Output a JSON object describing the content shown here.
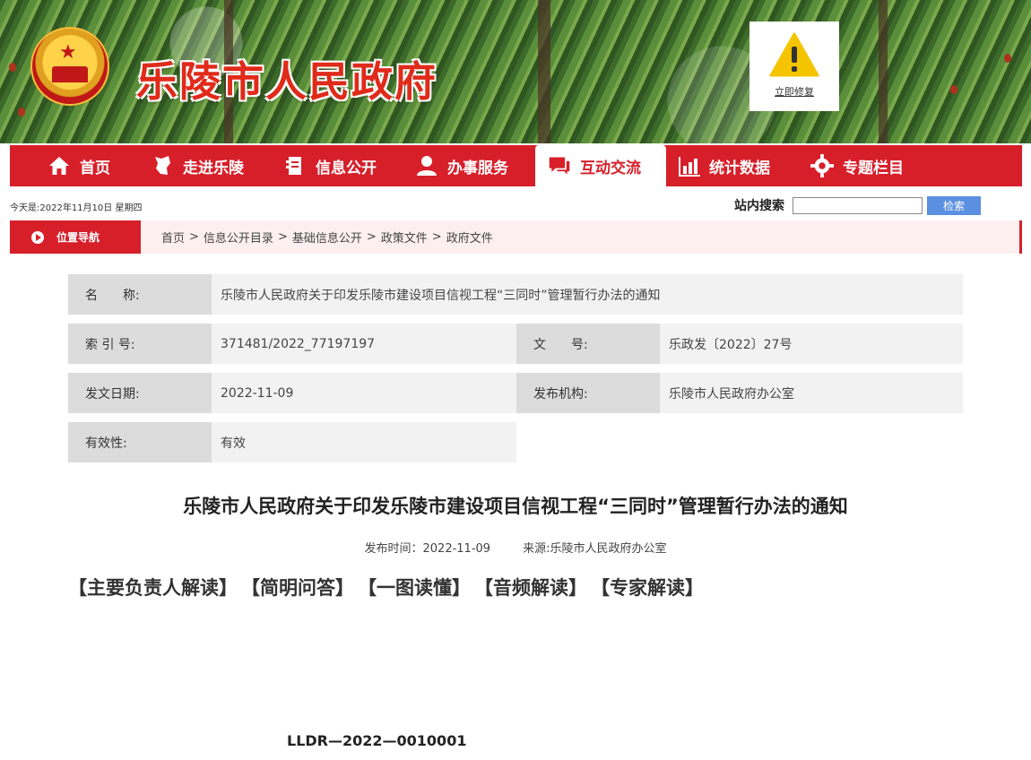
{
  "header": {
    "site_title": "乐陵市人民政府",
    "alert_link": "立即修复"
  },
  "nav": {
    "items": [
      {
        "label": "首页",
        "icon": "home-icon"
      },
      {
        "label": "走进乐陵",
        "icon": "map-icon"
      },
      {
        "label": "信息公开",
        "icon": "document-icon"
      },
      {
        "label": "办事服务",
        "icon": "person-icon"
      },
      {
        "label": "互动交流",
        "icon": "chat-icon",
        "active": true
      },
      {
        "label": "统计数据",
        "icon": "chart-icon"
      },
      {
        "label": "专题栏目",
        "icon": "gear-icon"
      }
    ]
  },
  "topbar": {
    "date": "今天是:2022年11月10日 星期四",
    "search_label": "站内搜索",
    "search_value": "",
    "search_button": "检索"
  },
  "location": {
    "tag": "位置导航",
    "crumbs": [
      "首页",
      "信息公开目录",
      "基础信息公开",
      "政策文件",
      "政府文件"
    ],
    "separator": ">"
  },
  "meta": {
    "name_label": "名　　称:",
    "name_value": "乐陵市人民政府关于印发乐陵市建设项目信视工程“三同时”管理暂行办法的通知",
    "index_label": "索 引 号:",
    "index_value": "371481/2022_77197197",
    "docno_label": "文　　号:",
    "docno_value": "乐政发〔2022〕27号",
    "date_label": "发文日期:",
    "date_value": "2022-11-09",
    "org_label": "发布机构:",
    "org_value": "乐陵市人民政府办公室",
    "validity_label": "有效性:",
    "validity_value": "有效"
  },
  "article": {
    "title": "乐陵市人民政府关于印发乐陵市建设项目信视工程“三同时”管理暂行办法的通知",
    "publish_time": "发布时间：2022-11-09",
    "source": "来源:乐陵市人民政府办公室",
    "interpretations": [
      "【主要负责人解读】",
      "【简明问答】",
      "【一图读懂】",
      "【音频解读】",
      "【专家解读】"
    ],
    "doc_code": "LLDR—2022—0010001"
  },
  "colors": {
    "brand_red": "#d71f2a",
    "search_blue": "#5b8fe0"
  }
}
